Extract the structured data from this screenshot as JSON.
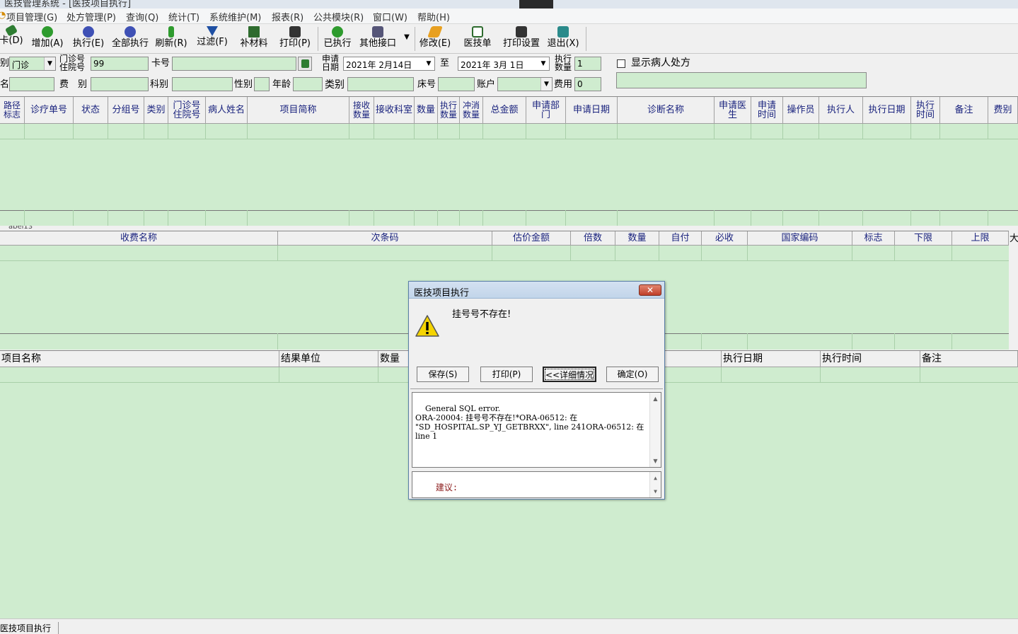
{
  "window": {
    "title": "医技管理系统 - [医技项目执行]"
  },
  "menu": [
    "项目管理(G)",
    "处方管理(P)",
    "查询(Q)",
    "统计(T)",
    "系统维护(M)",
    "报表(R)",
    "公共模块(R)",
    "窗口(W)",
    "帮助(H)"
  ],
  "toolbar": [
    {
      "label": "卡(D)",
      "icon": "card-icon",
      "color": "#2e7d32"
    },
    {
      "label": "增加(A)",
      "icon": "add-icon",
      "color": "#2e9b2e"
    },
    {
      "label": "执行(E)",
      "icon": "execute-icon",
      "color": "#3f51b5"
    },
    {
      "label": "全部执行",
      "icon": "execute-all-icon",
      "color": "#3f51b5"
    },
    {
      "label": "刷新(R)",
      "icon": "refresh-icon",
      "color": "#2e9b2e"
    },
    {
      "label": "过滤(F)",
      "icon": "filter-icon",
      "color": "#1e4fa3"
    },
    {
      "label": "补材料",
      "icon": "supplement-icon",
      "color": "#2e6b2e"
    },
    {
      "label": "打印(P)",
      "icon": "printer-icon",
      "color": "#333333"
    },
    {
      "label": "已执行",
      "icon": "executed-icon",
      "color": "#2e9b2e"
    },
    {
      "label": "其他接口",
      "icon": "interface-icon",
      "color": "#555577"
    },
    {
      "label": "修改(E)",
      "icon": "edit-icon",
      "color": "#e8a020"
    },
    {
      "label": "医技单",
      "icon": "form-icon",
      "color": "#2e6b2e"
    },
    {
      "label": "打印设置",
      "icon": "print-settings-icon",
      "color": "#333333"
    },
    {
      "label": "退出(X)",
      "icon": "exit-icon",
      "color": "#2a8a8a"
    }
  ],
  "filter": {
    "visit_type_label": "别",
    "visit_type_value": "门诊",
    "outpatient_no_label1": "门诊号",
    "outpatient_no_label2": "住院号",
    "outpatient_no_value": "99",
    "card_no_label": "卡号",
    "card_no_value": "",
    "apply_date_label1": "申请",
    "apply_date_label2": "日期",
    "date_from": "2021年 2月14日",
    "to_label": "至",
    "date_to": "2021年 3月 1日",
    "exec_qty_label1": "执行",
    "exec_qty_label2": "数量",
    "exec_qty_value": "1",
    "show_rx_label": "显示病人处方",
    "name_label": "名",
    "fee_type_label": "费　别",
    "dept_label": "科别",
    "sex_label": "性别",
    "age_label": "年龄",
    "category_label": "类别",
    "bed_label": "床号",
    "account_label": "账户",
    "cost_label": "费用",
    "cost_value": "0"
  },
  "grid1": {
    "headers": [
      "路径标志",
      "诊疗单号",
      "状态",
      "分组号",
      "类别",
      "门诊号住院号",
      "病人姓名",
      "项目简称",
      "接收数量",
      "接收科室",
      "数量",
      "执行数量",
      "冲消数量",
      "总金额",
      "申请部门",
      "申请日期",
      "诊断名称",
      "申请医生",
      "申请时间",
      "操作员",
      "执行人",
      "执行日期",
      "执行时间",
      "备注",
      "费别"
    ]
  },
  "grid2": {
    "fragment": "abel13",
    "headers": [
      "收费名称",
      "次条码",
      "估价金额",
      "倍数",
      "数量",
      "自付",
      "必收",
      "国家编码",
      "标志",
      "下限",
      "上限"
    ],
    "right_glyph": "大"
  },
  "grid3": {
    "headers": [
      "项目名称",
      "结果单位",
      "数量",
      "执行日期",
      "执行时间",
      "备注"
    ]
  },
  "dialog": {
    "title": "医技项目执行",
    "message": "挂号号不存在!",
    "buttons": {
      "save": "保存(S)",
      "print": "打印(P)",
      "details": "<<详细情况",
      "ok": "确定(O)"
    },
    "detail_text": "General SQL error.\nORA-20004: 挂号号不存在!*ORA-06512: 在\n\"SD_HOSPITAL.SP_YJ_GETBRXX\", line 241ORA-06512: 在\nline 1",
    "suggest_label": "建议:"
  },
  "status": {
    "tab": "医技项目执行"
  },
  "colors": {
    "grid_bg": "#cfeccf",
    "header_text": "#1a237e",
    "warning": "#f5d400"
  }
}
